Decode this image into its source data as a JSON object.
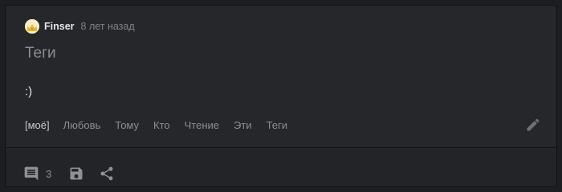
{
  "post": {
    "author": "Finser",
    "time_ago": "8 лет назад",
    "title": "Теги",
    "content": ":)",
    "tags": [
      "[моё]",
      "Любовь",
      "Тому",
      "Кто",
      "Чтение",
      "Эти",
      "Теги"
    ]
  },
  "footer": {
    "comment_count": "3"
  },
  "icons": {
    "edit": "pencil-icon",
    "comments": "comment-icon",
    "save": "floppy-disk-icon",
    "share": "share-icon"
  },
  "colors": {
    "page_background": "#1c1e21",
    "card_background": "#25272a",
    "footer_background": "#222427",
    "icon_color": "#8e9195"
  }
}
